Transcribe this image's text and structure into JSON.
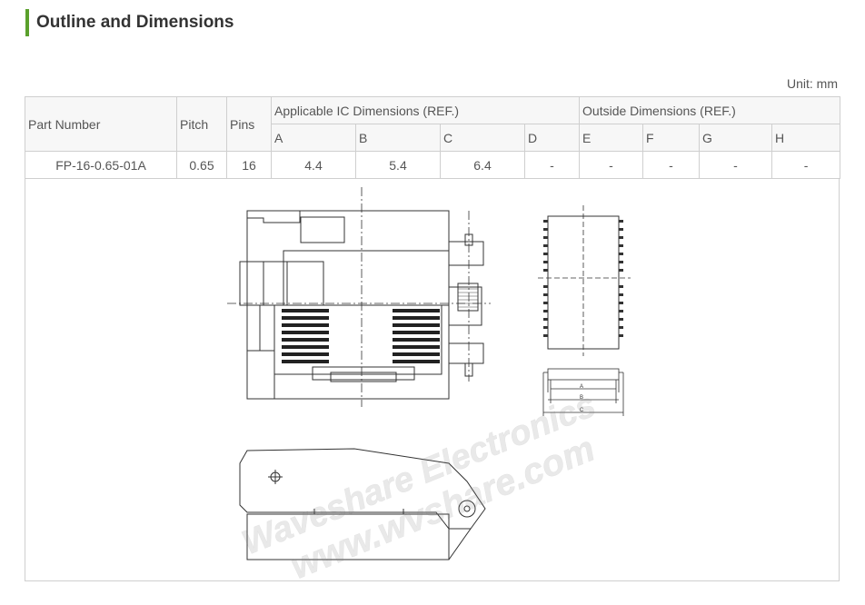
{
  "header": {
    "title": "Outline and Dimensions"
  },
  "unit_label": "Unit: mm",
  "table": {
    "part_number": "Part Number",
    "pitch": "Pitch",
    "pins": "Pins",
    "applicable_group": "Applicable IC Dimensions (REF.)",
    "outside_group": "Outside Dimensions (REF.)",
    "sub_headers": [
      "A",
      "B",
      "C",
      "D",
      "E",
      "F",
      "G",
      "H"
    ],
    "row": {
      "part_number": "FP-16-0.65-01A",
      "pitch": "0.65",
      "pins": "16",
      "values": [
        "4.4",
        "5.4",
        "6.4",
        "-",
        "-",
        "-",
        "-",
        "-"
      ]
    }
  },
  "drawing": {
    "dim_labels": [
      "A",
      "B",
      "C"
    ],
    "watermark_line1": "Waveshare Electronics",
    "watermark_line2": "www.wvshare.com"
  },
  "colors": {
    "accent": "#5aa02c",
    "border": "#cfcfcf",
    "line": "#333333"
  }
}
